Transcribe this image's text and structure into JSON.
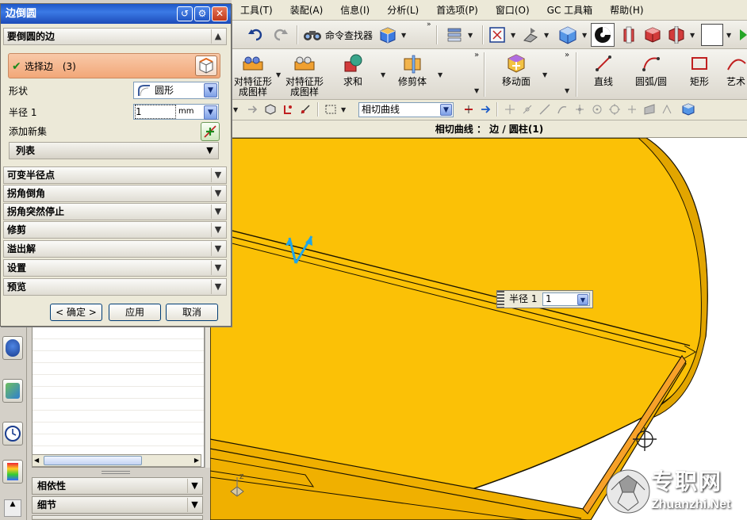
{
  "app": {
    "menu": [
      "工具(T)",
      "装配(A)",
      "信息(I)",
      "分析(L)",
      "首选项(P)",
      "窗口(O)",
      "GC 工具箱",
      "帮助(H)"
    ],
    "toolbar": {
      "command_finder_label": "命令查找器",
      "big_buttons": [
        {
          "line1": "对特征形",
          "line2": "成图样"
        },
        {
          "line1": "对特征形",
          "line2": "成图样"
        },
        {
          "line1": "求和",
          "line2": ""
        },
        {
          "line1": "修剪体",
          "line2": ""
        },
        {
          "line1": "移动面",
          "line2": ""
        },
        {
          "line1": "直线",
          "line2": ""
        },
        {
          "line1": "圆弧/圆",
          "line2": ""
        },
        {
          "line1": "矩形",
          "line2": ""
        },
        {
          "line1": "艺术",
          "line2": ""
        }
      ],
      "curve_rule_value": "相切曲线"
    },
    "cue_line": "相切曲线 ： 边 / 圆柱(1)"
  },
  "dialog": {
    "title": "边倒圆",
    "group_edges": "要倒圆的边",
    "select_edge_label": "选择边",
    "select_edge_count": "(3)",
    "shape_label": "形状",
    "shape_value": "圆形",
    "radius_label": "半径 1",
    "radius_value": "1",
    "radius_unit": "mm",
    "add_new_set_label": "添加新集",
    "list_label": "列表",
    "groups": [
      "可变半径点",
      "拐角倒角",
      "拐角突然停止",
      "修剪",
      "溢出解",
      "设置",
      "预览"
    ],
    "ok_label": "< 确定 >",
    "apply_label": "应用",
    "cancel_label": "取消"
  },
  "nav": {
    "panels": [
      "相依性",
      "细节"
    ]
  },
  "onscreen_input": {
    "label": "半径 1",
    "value": "1"
  },
  "watermark": {
    "cn": "专职网",
    "en": "Zhuanzhi.Net"
  },
  "colors": {
    "model_fill": "#fbc106",
    "model_edge": "#1a1400",
    "title_blue": "#2459c9",
    "select_highlight": "#f4b48a",
    "triad_cyan": "#1fa6e8"
  }
}
